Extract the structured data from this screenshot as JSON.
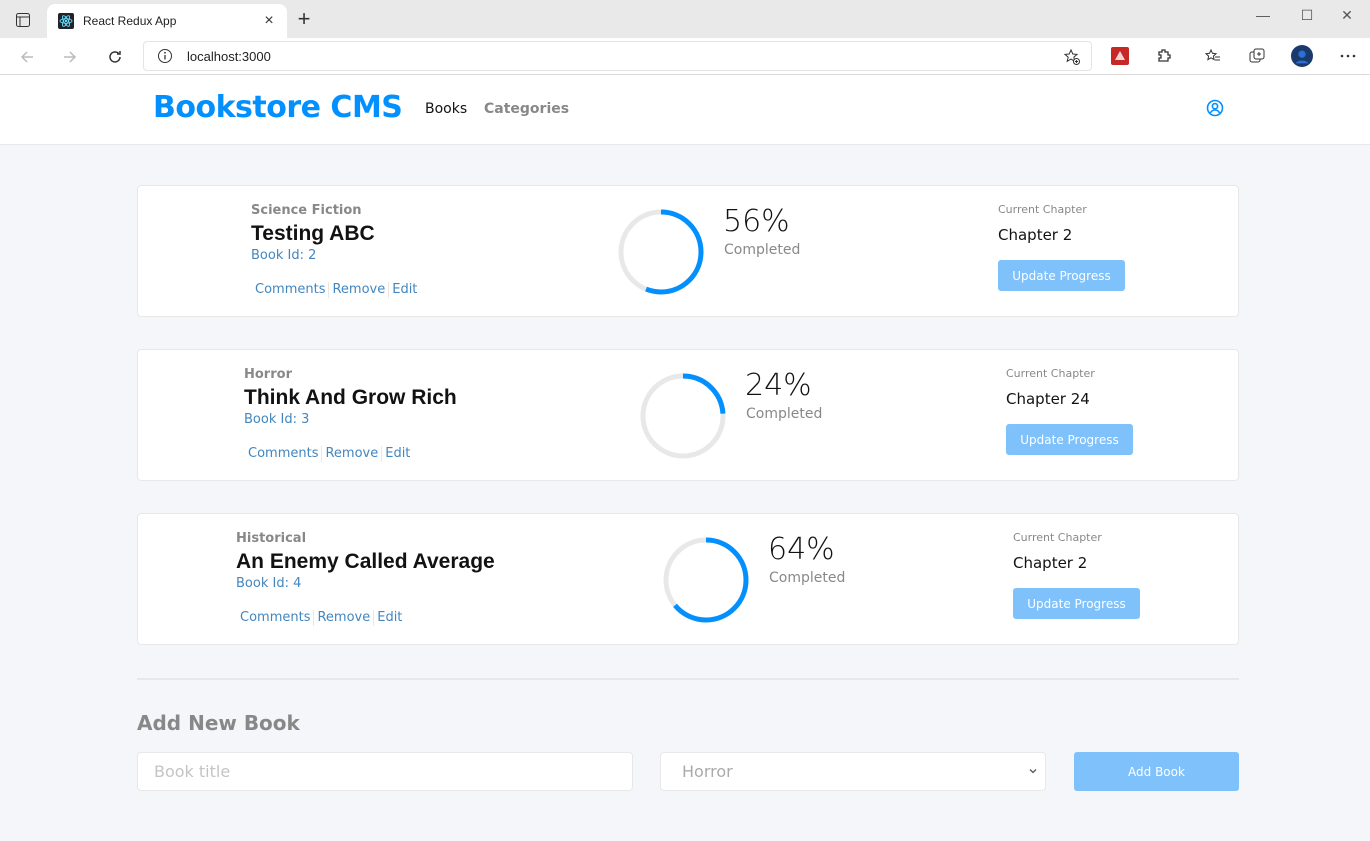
{
  "browser": {
    "tab_title": "React Redux App",
    "url": "localhost:3000"
  },
  "header": {
    "brand": "Bookstore CMS",
    "nav": [
      "Books",
      "Categories"
    ]
  },
  "books": [
    {
      "genre": "Science Fiction",
      "title": "Testing ABC",
      "book_id": "Book Id: 2",
      "percent": "56%",
      "progress": 0.56,
      "completed_label": "Completed",
      "current_label": "Current Chapter",
      "chapter": "Chapter 2"
    },
    {
      "genre": "Horror",
      "title": "Think And Grow Rich",
      "book_id": "Book Id: 3",
      "percent": "24%",
      "progress": 0.24,
      "completed_label": "Completed",
      "current_label": "Current Chapter",
      "chapter": "Chapter 24"
    },
    {
      "genre": "Historical",
      "title": "An Enemy Called Average",
      "book_id": "Book Id: 4",
      "percent": "64%",
      "progress": 0.64,
      "completed_label": "Completed",
      "current_label": "Current Chapter",
      "chapter": "Chapter 2"
    }
  ],
  "actions": [
    "Comments",
    "Remove",
    "Edit"
  ],
  "update_label": "Update Progress",
  "form": {
    "heading": "Add New Book",
    "title_placeholder": "Book title",
    "category_value": "Horror",
    "submit_label": "Add Book"
  },
  "colors": {
    "accent": "#0290ff",
    "button": "#7ec1fb",
    "link": "#4386bf",
    "ring_track": "#e8e8e8"
  }
}
